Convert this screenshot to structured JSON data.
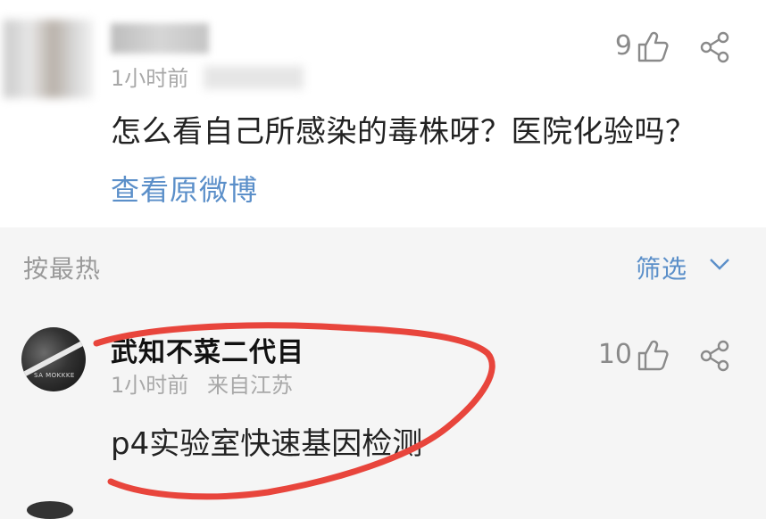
{
  "post": {
    "time": "1小时前",
    "likes": "9",
    "text": "怎么看自己所感染的毒株呀？医院化验吗？",
    "view_original": "查看原微博"
  },
  "comments_header": {
    "sort_label": "按最热",
    "filter_label": "筛选"
  },
  "comment": {
    "username": "武知不菜二代目",
    "time": "1小时前",
    "location": "来自江苏",
    "likes": "10",
    "text": "p4实验室快速基因检测",
    "avatar_text": "SA MOKKKE"
  },
  "annotation_color": "#e8453c",
  "link_color": "#5b8fc9"
}
